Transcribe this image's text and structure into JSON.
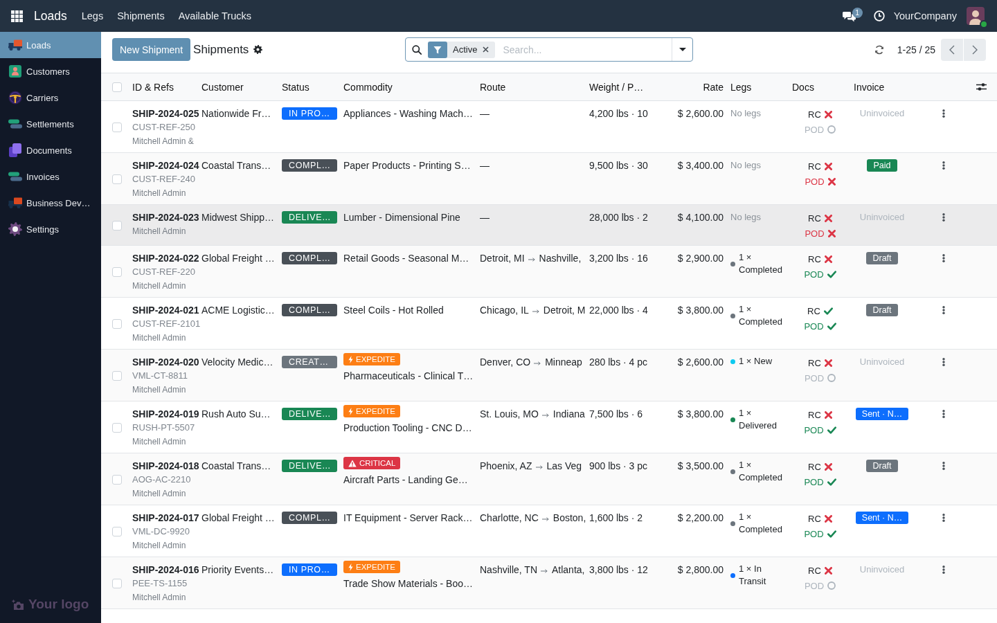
{
  "navbar": {
    "app_name": "Loads",
    "menu": [
      "Legs",
      "Shipments",
      "Available Trucks"
    ],
    "message_count": "1",
    "company": "YourCompany"
  },
  "sidebar": {
    "items": [
      {
        "label": "Loads",
        "selected": true
      },
      {
        "label": "Customers",
        "selected": false
      },
      {
        "label": "Carriers",
        "selected": false
      },
      {
        "label": "Settlements",
        "selected": false
      },
      {
        "label": "Documents",
        "selected": false
      },
      {
        "label": "Invoices",
        "selected": false
      },
      {
        "label": "Business Dev…",
        "selected": false
      },
      {
        "label": "Settings",
        "selected": false
      }
    ],
    "logo": "Your logo"
  },
  "control_panel": {
    "new_button": "New Shipment",
    "title": "Shipments",
    "search": {
      "facet": "Active",
      "placeholder": "Search..."
    },
    "pager": "1-25 / 25"
  },
  "table": {
    "select_all_checked": false,
    "columns": [
      "ID & Refs",
      "Customer",
      "Status",
      "Commodity",
      "Route",
      "Weight / P…",
      "Rate",
      "Legs",
      "Docs",
      "Invoice"
    ],
    "rows": [
      {
        "checked": false,
        "hovered": false,
        "id": "SHIP-2024-025",
        "ref": "CUST-REF-250",
        "owner": "Mitchell Admin &",
        "customer": "Nationwide Fr…",
        "status": {
          "label": "IN PRO…",
          "color": "#0d6efd"
        },
        "commodity": "Appliances - Washing Mach…",
        "route": {
          "kind": "none",
          "text": "—"
        },
        "weight": "4,200 lbs · 10",
        "rate": "$ 2,600.00",
        "legs": {
          "label": "No legs"
        },
        "docs": [
          {
            "label": "RC",
            "kind": "missing"
          },
          {
            "label": "POD",
            "kind": "pending"
          }
        ],
        "invoice": {
          "label": "Uninvoiced"
        }
      },
      {
        "checked": false,
        "hovered": false,
        "id": "SHIP-2024-024",
        "ref": "CUST-REF-240",
        "owner": "Mitchell Admin",
        "customer": "Coastal Trans…",
        "status": {
          "label": "COMPL…",
          "color": "#495057"
        },
        "commodity": "Paper Products - Printing S…",
        "route": {
          "kind": "none",
          "text": "—"
        },
        "weight": "9,500 lbs · 30",
        "rate": "$ 3,400.00",
        "legs": {
          "label": "No legs"
        },
        "docs": [
          {
            "label": "RC",
            "kind": "missing"
          },
          {
            "label": "POD",
            "kind": "missing"
          }
        ],
        "invoice": {
          "label": "Paid",
          "color": "#198754"
        }
      },
      {
        "checked": false,
        "hovered": true,
        "id": "SHIP-2024-023",
        "owner": "Mitchell Admin",
        "customer": "Midwest Shipp…",
        "status": {
          "label": "DELIVE…",
          "color": "#198754"
        },
        "commodity": "Lumber - Dimensional Pine",
        "route": {
          "kind": "none",
          "text": "—"
        },
        "weight": "28,000 lbs · 2",
        "rate": "$ 4,100.00",
        "legs": {
          "label": "No legs"
        },
        "docs": [
          {
            "label": "RC",
            "kind": "missing"
          },
          {
            "label": "POD",
            "kind": "missing"
          }
        ],
        "invoice": {
          "label": "Uninvoiced"
        }
      },
      {
        "checked": false,
        "hovered": false,
        "id": "SHIP-2024-022",
        "ref": "CUST-REF-220",
        "owner": "Mitchell Admin",
        "customer": "Global Freight …",
        "status": {
          "label": "COMPL…",
          "color": "#495057"
        },
        "commodity": "Retail Goods - Seasonal M…",
        "route": {
          "kind": "lane",
          "from": "Detroit, MI",
          "to": "Nashville,"
        },
        "weight": "3,200 lbs · 16",
        "rate": "$ 2,900.00",
        "legs": {
          "label": "1 × Completed",
          "color": "#6c757d"
        },
        "docs": [
          {
            "label": "RC",
            "kind": "missing"
          },
          {
            "label": "POD",
            "kind": "ok"
          }
        ],
        "invoice": {
          "label": "Draft",
          "color": "#6c757d"
        }
      },
      {
        "checked": false,
        "hovered": false,
        "id": "SHIP-2024-021",
        "ref": "CUST-REF-2101",
        "owner": "Mitchell Admin",
        "customer": "ACME Logistic…",
        "status": {
          "label": "COMPL…",
          "color": "#495057"
        },
        "commodity": "Steel Coils - Hot Rolled",
        "route": {
          "kind": "lane",
          "from": "Chicago, IL",
          "to": "Detroit, M"
        },
        "weight": "22,000 lbs · 4",
        "rate": "$ 3,800.00",
        "legs": {
          "label": "1 × Completed",
          "color": "#6c757d"
        },
        "docs": [
          {
            "label": "RC",
            "kind": "ok"
          },
          {
            "label": "POD",
            "kind": "ok"
          }
        ],
        "invoice": {
          "label": "Draft",
          "color": "#6c757d"
        }
      },
      {
        "checked": false,
        "hovered": false,
        "id": "SHIP-2024-020",
        "ref": "VML-CT-8811",
        "owner": "Mitchell Admin",
        "customer": "Velocity Medic…",
        "status": {
          "label": "CREAT…",
          "color": "#6c757d"
        },
        "priority": {
          "kind": "expedite",
          "label": "EXPEDITE",
          "color": "#fd7e14"
        },
        "commodity": "Pharmaceuticals - Clinical T…",
        "route": {
          "kind": "lane",
          "from": "Denver, CO",
          "to": "Minneap"
        },
        "weight": "280 lbs · 4 pc",
        "rate": "$ 2,600.00",
        "legs": {
          "label": "1 × New",
          "color": "#0dcaf0"
        },
        "docs": [
          {
            "label": "RC",
            "kind": "missing"
          },
          {
            "label": "POD",
            "kind": "pending"
          }
        ],
        "invoice": {
          "label": "Uninvoiced"
        }
      },
      {
        "checked": false,
        "hovered": false,
        "id": "SHIP-2024-019",
        "ref": "RUSH-PT-5507",
        "owner": "Mitchell Admin",
        "customer": "Rush Auto Su…",
        "status": {
          "label": "DELIVE…",
          "color": "#198754"
        },
        "priority": {
          "kind": "expedite",
          "label": "EXPEDITE",
          "color": "#fd7e14"
        },
        "commodity": "Production Tooling - CNC D…",
        "route": {
          "kind": "lane",
          "from": "St. Louis, MO",
          "to": "Indiana"
        },
        "weight": "7,500 lbs · 6",
        "rate": "$ 3,800.00",
        "legs": {
          "label": "1 × Delivered",
          "color": "#198754"
        },
        "docs": [
          {
            "label": "RC",
            "kind": "missing"
          },
          {
            "label": "POD",
            "kind": "ok"
          }
        ],
        "invoice": {
          "label": "Sent · N…",
          "color": "#0d6efd"
        }
      },
      {
        "checked": false,
        "hovered": false,
        "id": "SHIP-2024-018",
        "ref": "AOG-AC-2210",
        "owner": "Mitchell Admin",
        "customer": "Coastal Trans…",
        "status": {
          "label": "DELIVE…",
          "color": "#198754"
        },
        "priority": {
          "kind": "critical",
          "label": "CRITICAL",
          "color": "#dc3545"
        },
        "commodity": "Aircraft Parts - Landing Ge…",
        "route": {
          "kind": "lane",
          "from": "Phoenix, AZ",
          "to": "Las Veg"
        },
        "weight": "900 lbs · 3 pc",
        "rate": "$ 3,500.00",
        "legs": {
          "label": "1 × Completed",
          "color": "#6c757d"
        },
        "docs": [
          {
            "label": "RC",
            "kind": "missing"
          },
          {
            "label": "POD",
            "kind": "ok"
          }
        ],
        "invoice": {
          "label": "Draft",
          "color": "#6c757d"
        }
      },
      {
        "checked": false,
        "hovered": false,
        "id": "SHIP-2024-017",
        "ref": "VML-DC-9920",
        "owner": "Mitchell Admin",
        "customer": "Global Freight …",
        "status": {
          "label": "COMPL…",
          "color": "#495057"
        },
        "commodity": "IT Equipment - Server Rack…",
        "route": {
          "kind": "lane",
          "from": "Charlotte, NC",
          "to": "Boston,"
        },
        "weight": "1,600 lbs · 2",
        "rate": "$ 2,200.00",
        "legs": {
          "label": "1 × Completed",
          "color": "#6c757d"
        },
        "docs": [
          {
            "label": "RC",
            "kind": "missing"
          },
          {
            "label": "POD",
            "kind": "ok"
          }
        ],
        "invoice": {
          "label": "Sent · N…",
          "color": "#0d6efd"
        }
      },
      {
        "checked": false,
        "hovered": false,
        "id": "SHIP-2024-016",
        "ref": "PEE-TS-1155",
        "owner": "Mitchell Admin",
        "customer": "Priority Events…",
        "status": {
          "label": "IN PRO…",
          "color": "#0d6efd"
        },
        "priority": {
          "kind": "expedite",
          "label": "EXPEDITE",
          "color": "#fd7e14"
        },
        "commodity": "Trade Show Materials - Boo…",
        "route": {
          "kind": "lane",
          "from": "Nashville, TN",
          "to": "Atlanta,"
        },
        "weight": "3,800 lbs · 12",
        "rate": "$ 2,800.00",
        "legs": {
          "label": "1 × In Transit",
          "color": "#0d6efd"
        },
        "docs": [
          {
            "label": "RC",
            "kind": "missing"
          },
          {
            "label": "POD",
            "kind": "pending"
          }
        ],
        "invoice": {
          "label": "Uninvoiced"
        }
      }
    ]
  }
}
